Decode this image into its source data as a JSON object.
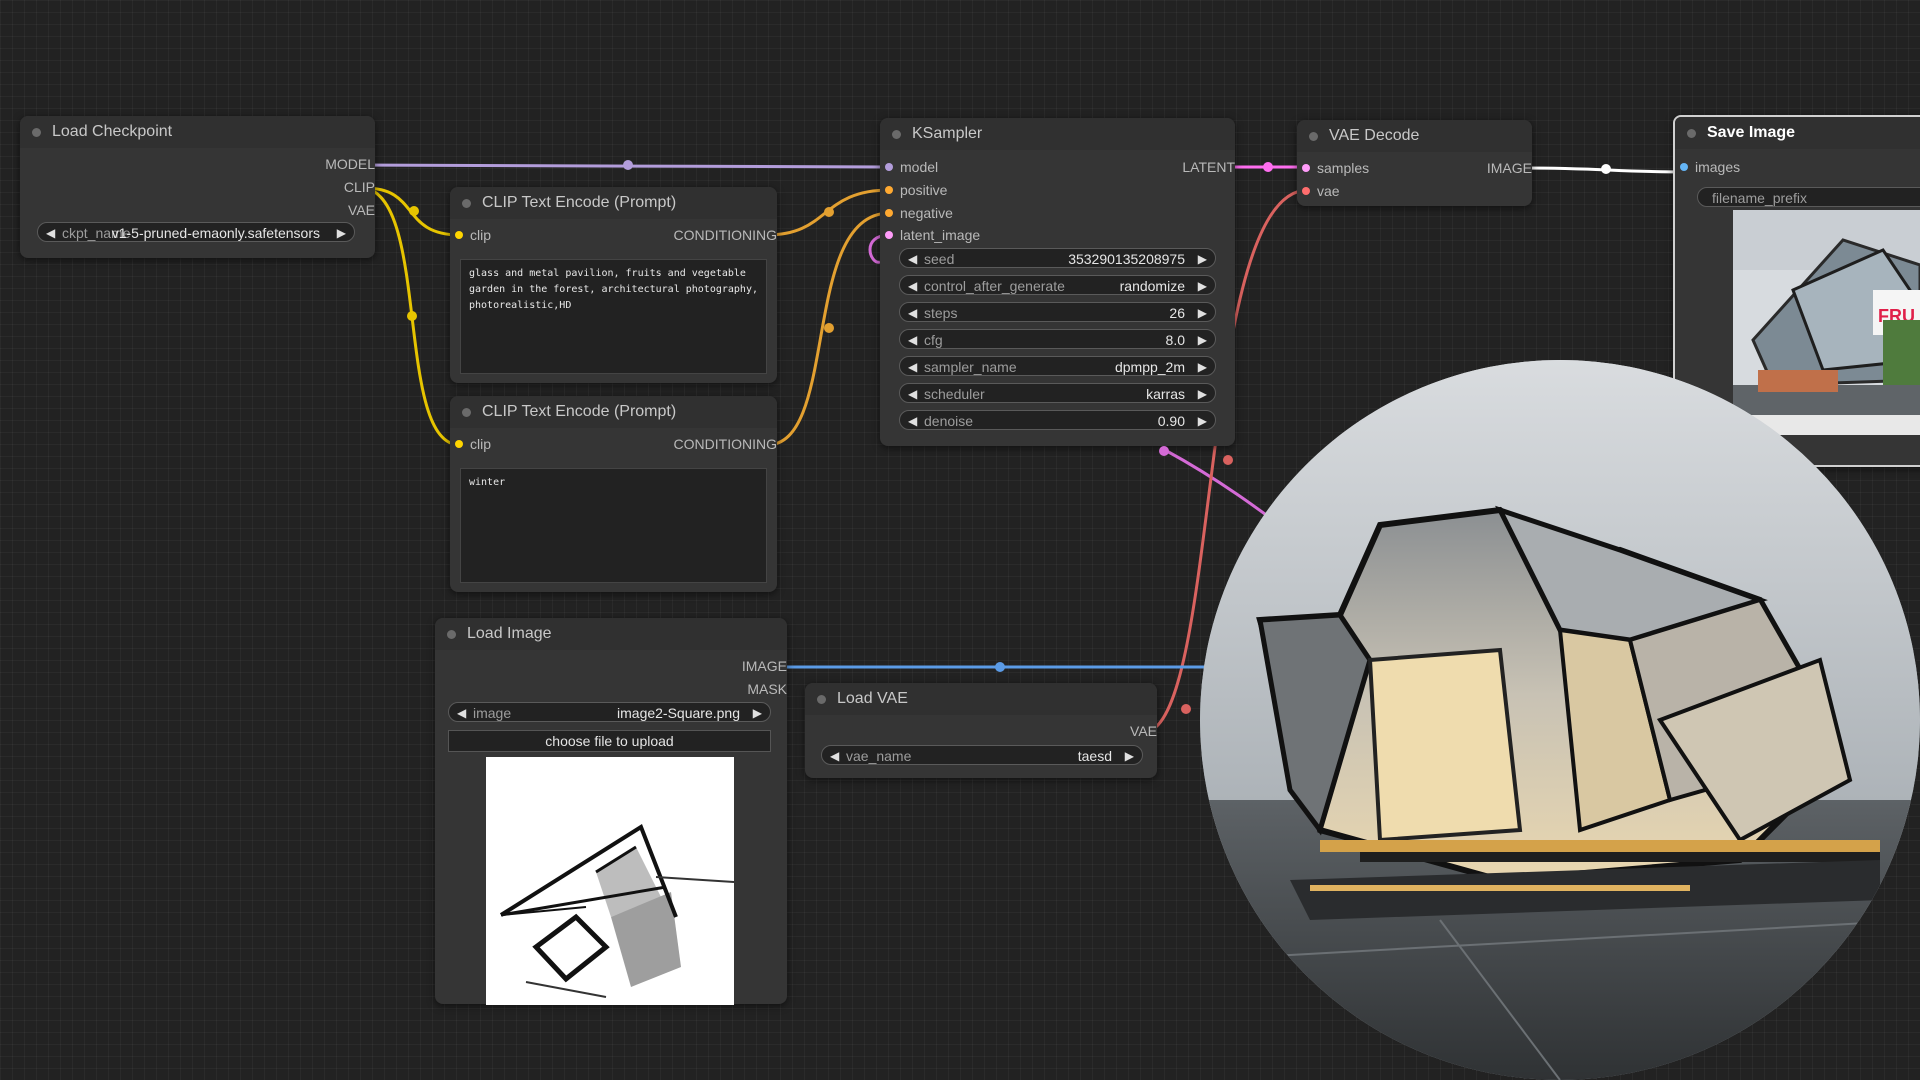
{
  "nodes": {
    "load_checkpoint": {
      "title": "Load Checkpoint",
      "outputs": [
        "MODEL",
        "CLIP",
        "VAE"
      ],
      "widget": {
        "label": "ckpt_name",
        "value": "v1-5-pruned-emaonly.safetensors"
      }
    },
    "clip_text_encode_1": {
      "title": "CLIP Text Encode (Prompt)",
      "input": "clip",
      "output": "CONDITIONING",
      "text": "glass and metal pavilion, fruits and vegetable garden in the forest, architectural photography, photorealistic,HD"
    },
    "clip_text_encode_2": {
      "title": "CLIP Text Encode (Prompt)",
      "input": "clip",
      "output": "CONDITIONING",
      "text": "winter"
    },
    "ksampler": {
      "title": "KSampler",
      "inputs": [
        "model",
        "positive",
        "negative",
        "latent_image"
      ],
      "output": "LATENT",
      "widgets": [
        {
          "label": "seed",
          "value": "353290135208975"
        },
        {
          "label": "control_after_generate",
          "value": "randomize"
        },
        {
          "label": "steps",
          "value": "26"
        },
        {
          "label": "cfg",
          "value": "8.0"
        },
        {
          "label": "sampler_name",
          "value": "dpmpp_2m"
        },
        {
          "label": "scheduler",
          "value": "karras"
        },
        {
          "label": "denoise",
          "value": "0.90"
        }
      ]
    },
    "vae_decode": {
      "title": "VAE Decode",
      "inputs": [
        "samples",
        "vae"
      ],
      "output": "IMAGE"
    },
    "save_image": {
      "title": "Save Image",
      "input": "images",
      "widget_label": "filename_prefix"
    },
    "load_image": {
      "title": "Load Image",
      "outputs": [
        "IMAGE",
        "MASK"
      ],
      "widget": {
        "label": "image",
        "value": "image2-Square.png"
      },
      "upload_label": "choose file to upload"
    },
    "load_vae": {
      "title": "Load VAE",
      "output": "VAE",
      "widget": {
        "label": "vae_name",
        "value": "taesd"
      }
    }
  },
  "colors": {
    "model": "#b39ddb",
    "clip": "#ffd500",
    "vae": "#ff6e6e",
    "conditioning": "#ffa931",
    "latent": "#ff9cf9",
    "image": "#64b5f6",
    "mask": "#81c784",
    "canvas": "#222222",
    "node": "#353535"
  },
  "icons": [
    "arrow-left-icon",
    "arrow-right-icon",
    "node-dot-icon"
  ]
}
